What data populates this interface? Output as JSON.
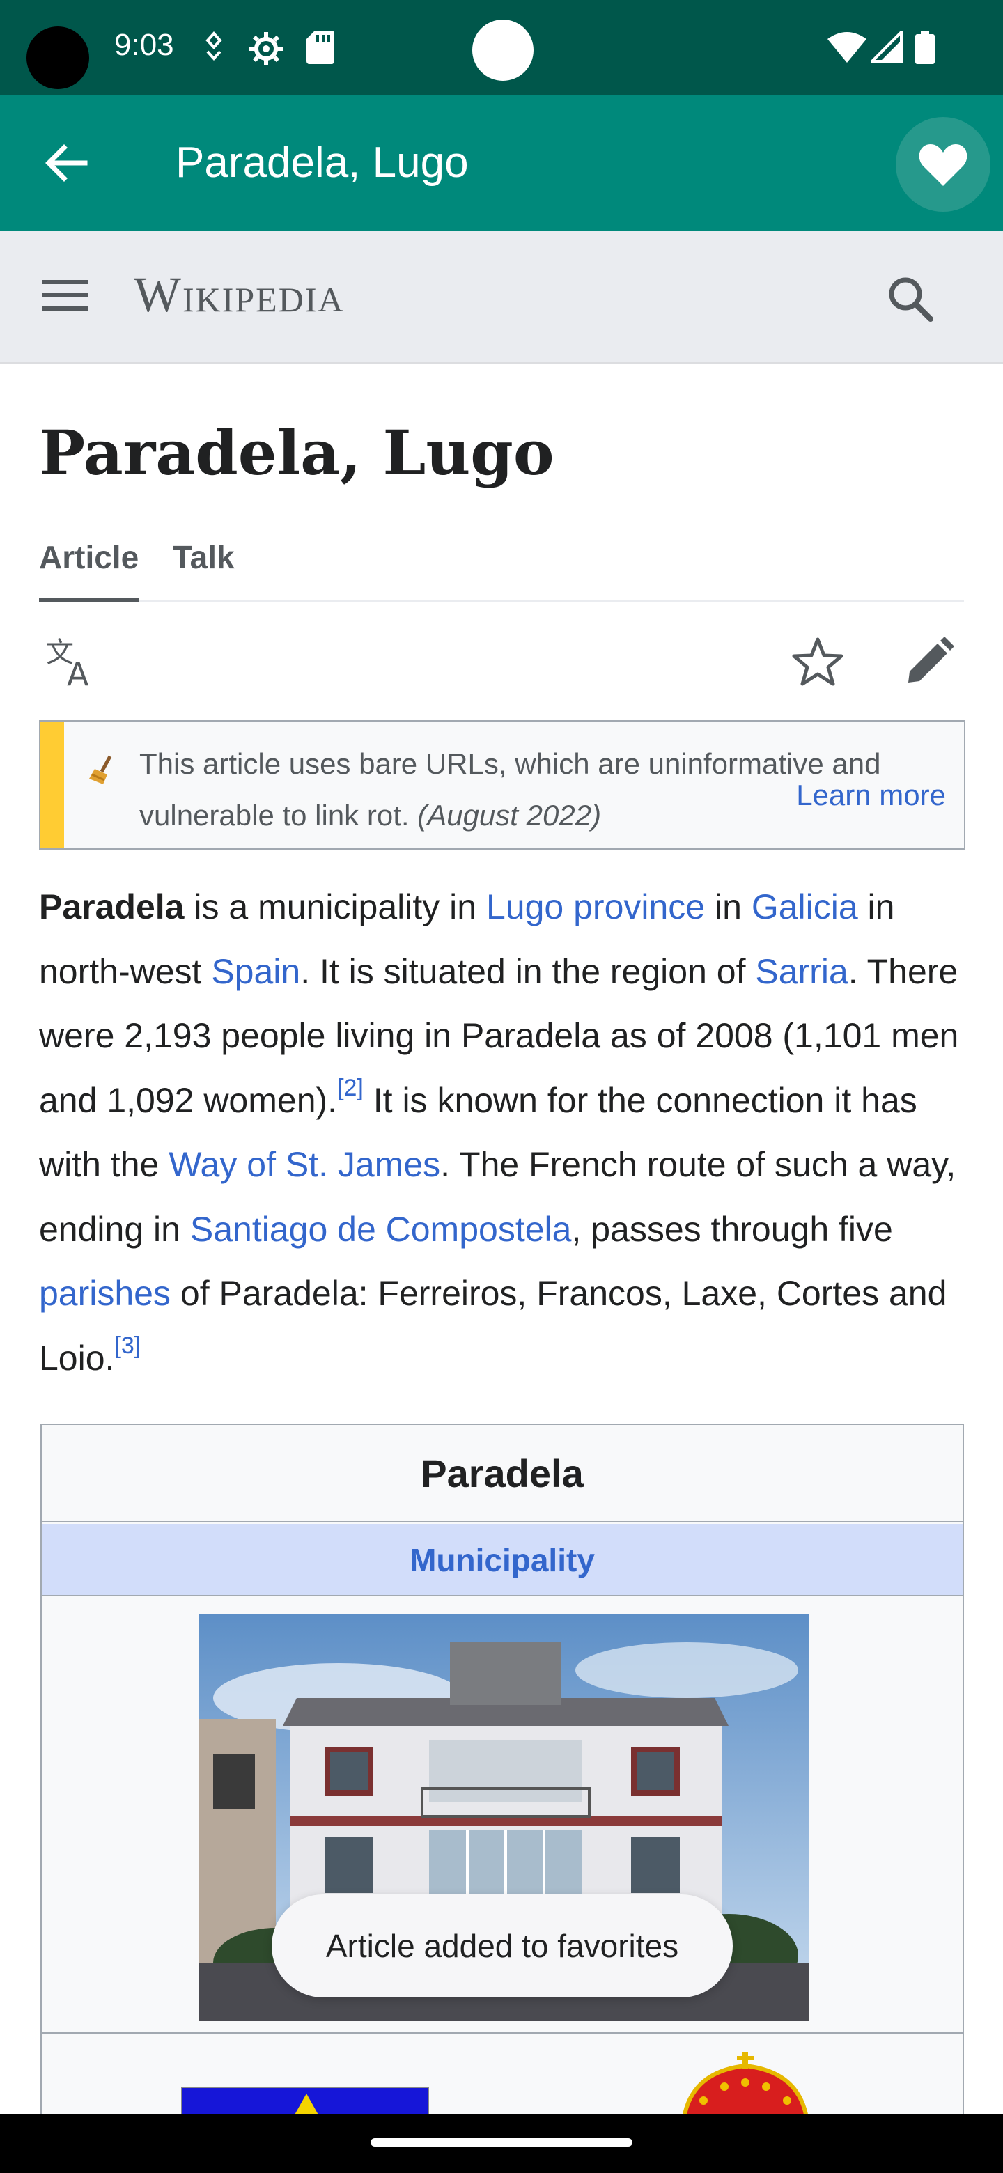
{
  "status_bar": {
    "time": "9:03"
  },
  "app_bar": {
    "title": "Paradela, Lugo"
  },
  "wiki": {
    "wordmark": "Wikipedia"
  },
  "article": {
    "title": "Paradela, Lugo",
    "tabs": [
      {
        "label": "Article",
        "active": true
      },
      {
        "label": "Talk",
        "active": false
      }
    ],
    "notice": {
      "text": "This article uses bare URLs, which are uninformative and vulnerable to link rot.",
      "date": "(August 2022)",
      "learn_more": "Learn more"
    },
    "paragraph": {
      "bold_lead": "Paradela",
      "t1": " is a municipality in ",
      "link_lugo": "Lugo province",
      "t2": " in ",
      "link_galicia": "Galicia",
      "t3": " in north-west ",
      "link_spain": "Spain",
      "t4": ". It is situated in the region of ",
      "link_sarria": "Sarria",
      "t5": ". There were 2,193 people living in Paradela as of 2008 (1,101 men and 1,092 women).",
      "ref2": "[2]",
      "t6": " It is known for the connection it has with the ",
      "link_way": "Way of St. James",
      "t7": ". The French route of such a way, ending in ",
      "link_santiago": "Santiago de Compostela",
      "t8": ", passes through five ",
      "link_parishes": "parishes",
      "t9": " of Paradela: Ferreiros, Francos, Laxe, Cortes and Loio.",
      "ref3": "[3]"
    },
    "infobox": {
      "title": "Paradela",
      "subtitle": "Municipality"
    }
  },
  "toast": {
    "text": "Article added to favorites"
  },
  "colors": {
    "status_bar": "#00574b",
    "app_bar": "#00897b",
    "link": "#3366cc",
    "notice_accent": "#ffcc33"
  }
}
